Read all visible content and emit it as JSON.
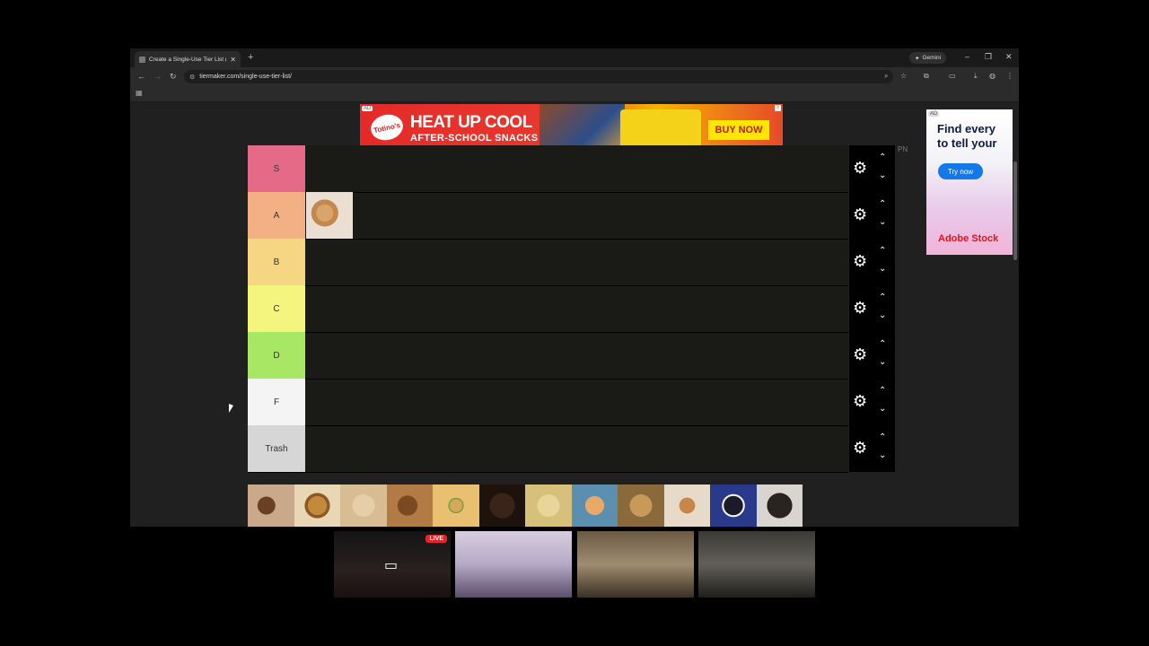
{
  "browser": {
    "tab_title": "Create a Single-Use Tier List (F",
    "new_tab": "+",
    "gemini_label": "Gemini",
    "url": "tiermaker.com/single-use-tier-list/"
  },
  "ads": {
    "top": {
      "tag": "AD",
      "brand": "Totino's",
      "headline": "HEAT UP COOL",
      "subline": "AFTER-SCHOOL SNACKS",
      "cta": "BUY NOW"
    },
    "side": {
      "tag": "AD",
      "headline_1": "Find every",
      "headline_2": "to tell your",
      "cta": "Try now",
      "brand": "Adobe Stock"
    }
  },
  "tiers": [
    {
      "label": "S",
      "color": "#e46a87"
    },
    {
      "label": "A",
      "color": "#f3b085"
    },
    {
      "label": "B",
      "color": "#f6d583"
    },
    {
      "label": "C",
      "color": "#f4f57f"
    },
    {
      "label": "D",
      "color": "#a8e764"
    },
    {
      "label": "F",
      "color": "#f4f4f4"
    },
    {
      "label": "Trash",
      "color": "#d6d6d6"
    }
  ],
  "side_partial_text": "PN",
  "pool_item_count": 12,
  "call": {
    "live_badge": "LIVE"
  }
}
